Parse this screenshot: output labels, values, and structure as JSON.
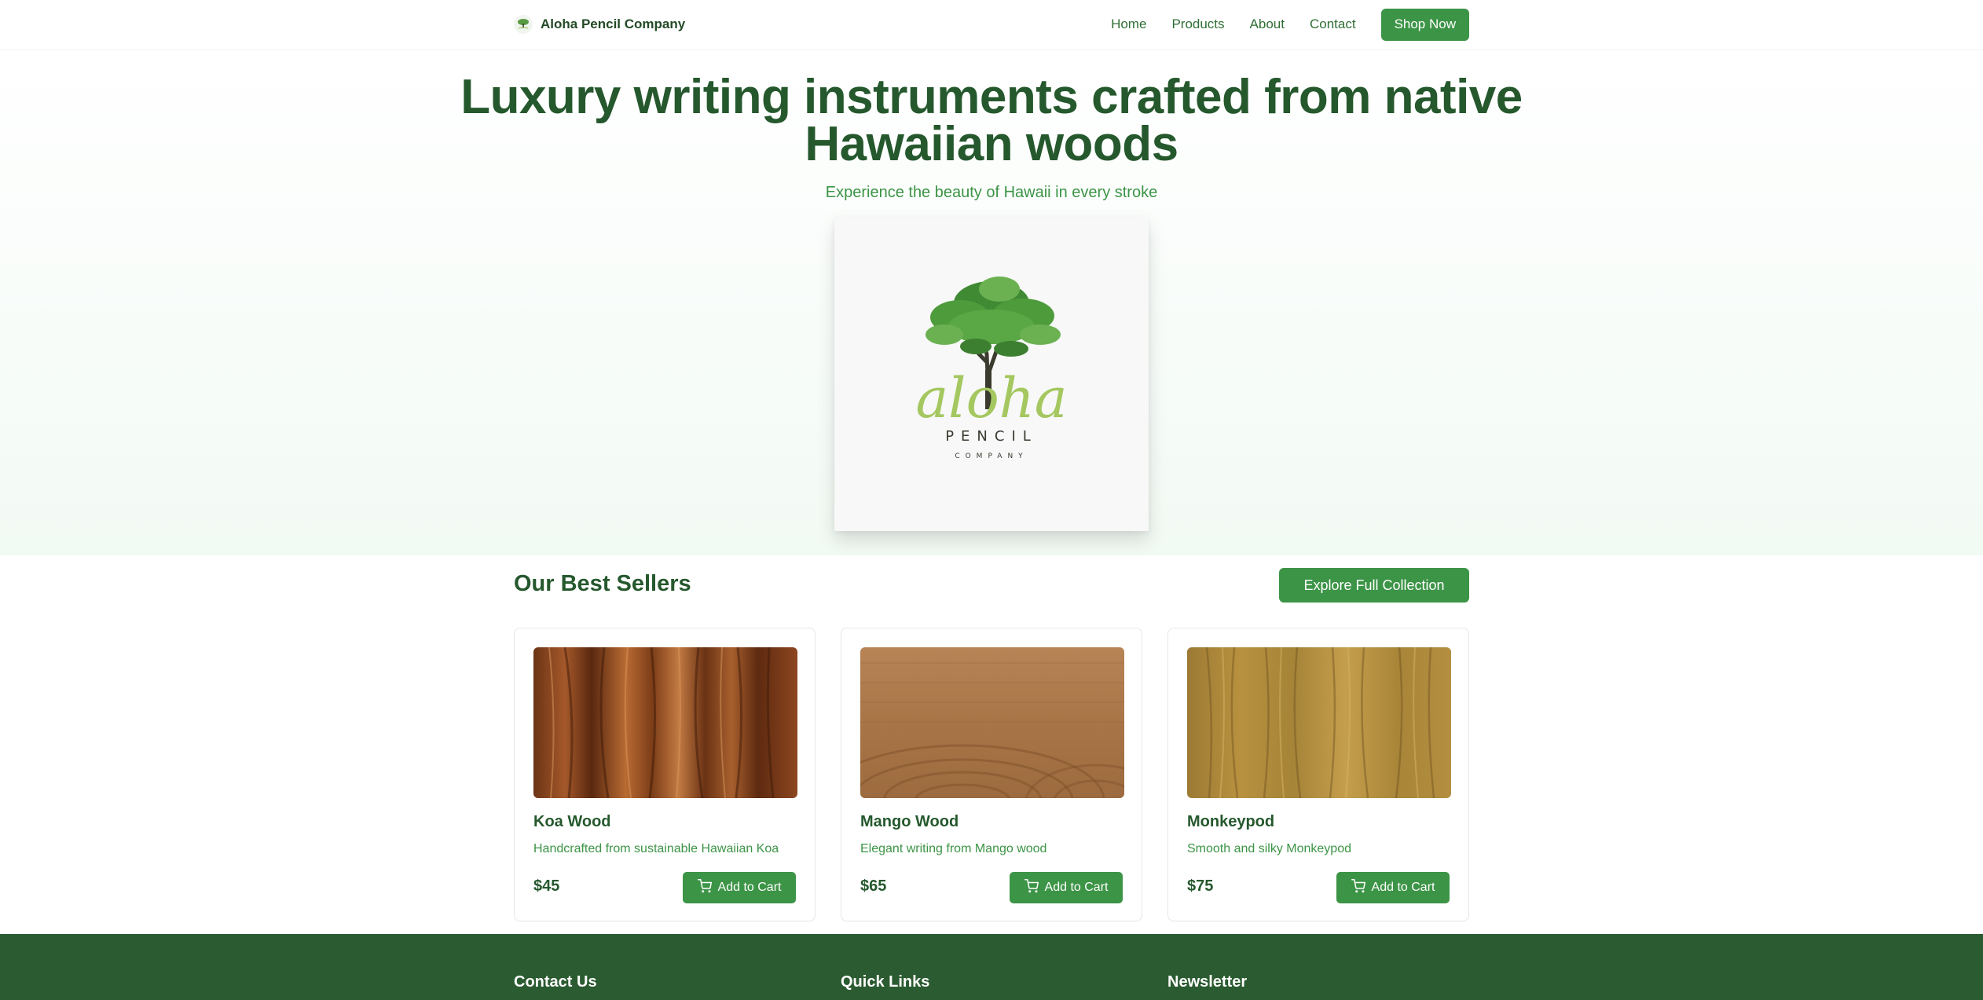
{
  "nav": {
    "brand": "Aloha Pencil Company",
    "links": [
      "Home",
      "Products",
      "About",
      "Contact"
    ],
    "cta": "Shop Now"
  },
  "hero": {
    "title": "Luxury writing instruments crafted from native Hawaiian woods",
    "subtitle": "Experience the beauty of Hawaii in every stroke",
    "logo": {
      "script": "aloha",
      "line1": "PENCIL",
      "line2": "COMPANY"
    }
  },
  "best_sellers": {
    "title": "Our Best Sellers",
    "explore_label": "Explore Full Collection",
    "products": [
      {
        "name": "Koa Wood",
        "description": "Handcrafted from sustainable Hawaiian Koa",
        "price": "$45",
        "cart_label": "Add to Cart"
      },
      {
        "name": "Mango Wood",
        "description": "Elegant writing from Mango wood",
        "price": "$65",
        "cart_label": "Add to Cart"
      },
      {
        "name": "Monkeypod",
        "description": "Smooth and silky Monkeypod",
        "price": "$75",
        "cart_label": "Add to Cart"
      }
    ]
  },
  "footer": {
    "contact_title": "Contact Us",
    "links_title": "Quick Links",
    "newsletter_title": "Newsletter"
  },
  "colors": {
    "brand_green": "#3c9446",
    "dark_green": "#25582d",
    "footer_green": "#2b5b30"
  },
  "icons": [
    "tree-icon",
    "cart-icon"
  ]
}
